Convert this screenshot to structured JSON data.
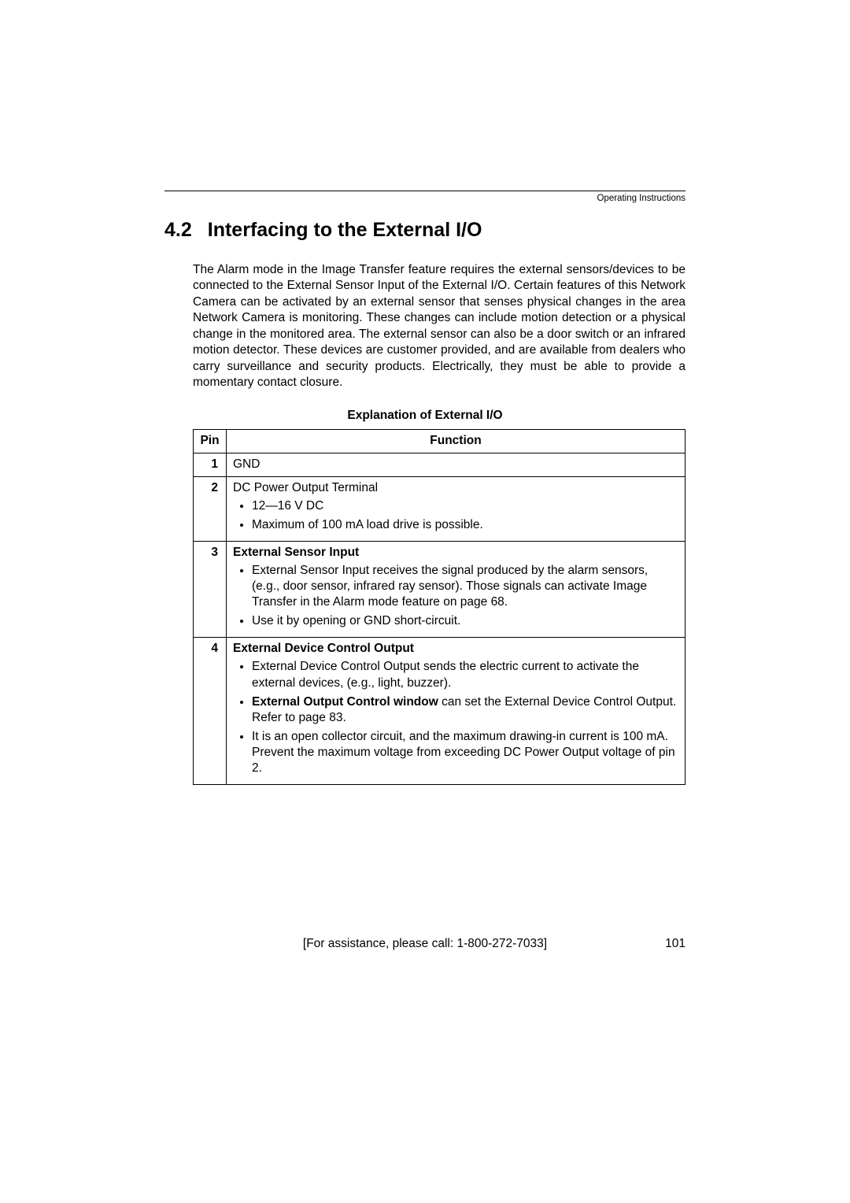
{
  "running_head": "Operating Instructions",
  "section": {
    "number": "4.2",
    "title": "Interfacing to the External I/O"
  },
  "paragraph": "The Alarm mode in the Image Transfer feature requires the external sensors/devices to be connected to the External Sensor Input of the External I/O. Certain features of this Network Camera can be activated by an external sensor that senses physical changes in the area Network Camera is monitoring. These changes can include motion detection or a physical change in the monitored area. The external sensor can also be a door switch or an infrared motion detector. These devices are customer provided, and are available from dealers who carry surveillance and security products. Electrically, they must be able to provide a momentary contact closure.",
  "table": {
    "caption": "Explanation of External I/O",
    "headers": {
      "pin": "Pin",
      "function": "Function"
    },
    "rows": {
      "r1": {
        "pin": "1",
        "text": "GND"
      },
      "r2": {
        "pin": "2",
        "title": "DC Power Output Terminal",
        "b1": "12—16 V DC",
        "b2": "Maximum of 100 mA load drive is possible."
      },
      "r3": {
        "pin": "3",
        "title": "External Sensor Input",
        "b1": "External Sensor Input receives the signal produced by the alarm sensors, (e.g., door sensor, infrared ray sensor). Those signals can activate Image Transfer in the Alarm mode feature on page 68.",
        "b2": "Use it by opening or GND short-circuit."
      },
      "r4": {
        "pin": "4",
        "title": "External Device Control Output",
        "b1": "External Device Control Output sends the electric current to activate the external devices, (e.g., light, buzzer).",
        "b2_bold": "External Output Control window",
        "b2_rest": " can set the External Device Control Output. Refer to page 83.",
        "b3": "It is an open collector circuit, and the maximum drawing-in current is 100 mA. Prevent the maximum voltage from exceeding DC Power Output voltage of pin 2."
      }
    }
  },
  "footer": {
    "assist": "[For assistance, please call: 1-800-272-7033]",
    "page": "101"
  }
}
